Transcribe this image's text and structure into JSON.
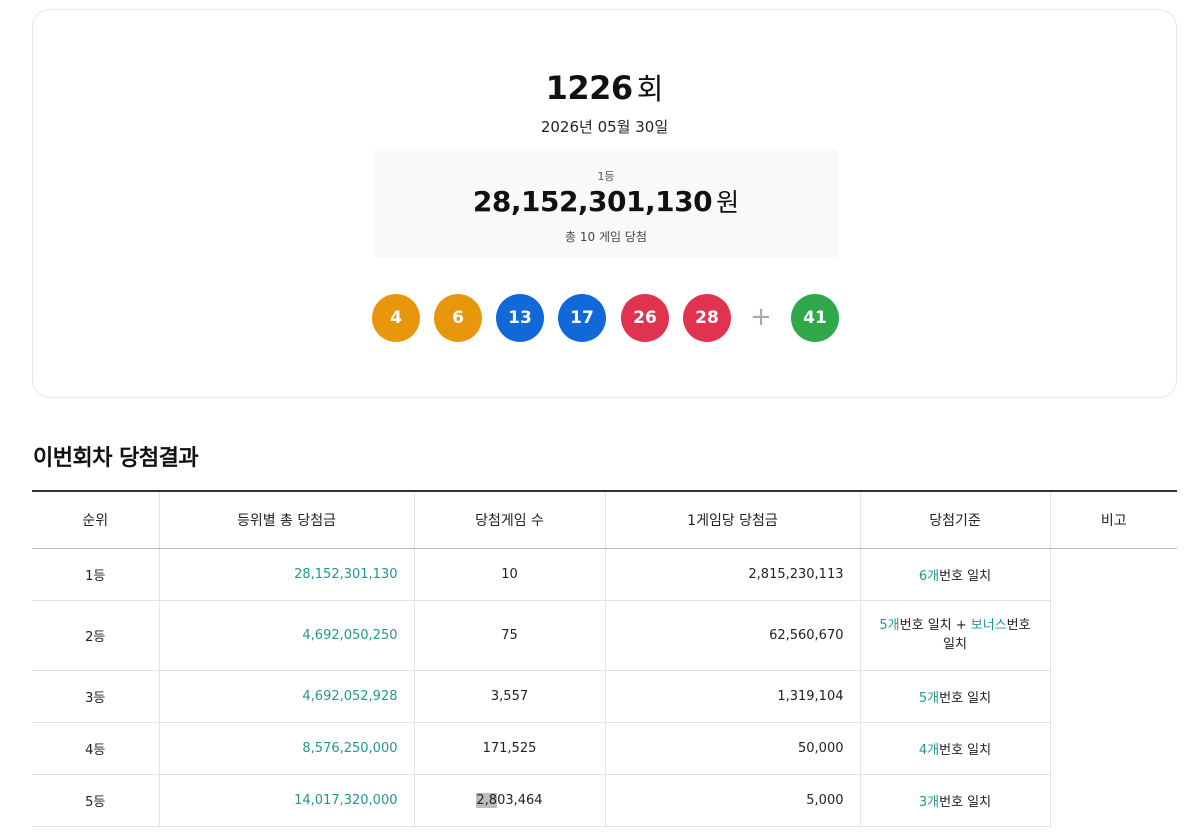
{
  "draw": {
    "number": "1226",
    "unit": "회",
    "date": "2026년 05월 30일"
  },
  "first_prize": {
    "rank": "1등",
    "amount": "28,152,301,130",
    "currency": "원",
    "winners_text": "총 10 게임 당첨"
  },
  "balls": [
    {
      "number": "4",
      "color": "#e8960c"
    },
    {
      "number": "6",
      "color": "#e8960c"
    },
    {
      "number": "13",
      "color": "#1168d8"
    },
    {
      "number": "17",
      "color": "#1168d8"
    },
    {
      "number": "26",
      "color": "#e0334f"
    },
    {
      "number": "28",
      "color": "#e0334f"
    }
  ],
  "plus_sign": "+",
  "bonus_ball": {
    "number": "41",
    "color": "#2fa84a"
  },
  "section_title": "이번회차 당첨결과",
  "table": {
    "headers": [
      "순위",
      "등위별 총 당첨금",
      "당첨게임 수",
      "1게임당 당첨금",
      "당첨기준",
      "비고"
    ],
    "rows": [
      {
        "rank": "1등",
        "total": "28,152,301,130",
        "count": "10",
        "per_game": "2,815,230,113",
        "crit_num": "6개",
        "crit_text": "번호 일치"
      },
      {
        "rank": "2등",
        "total": "4,692,050,250",
        "count": "75",
        "per_game": "62,560,670",
        "crit_num": "5개",
        "crit_text": "번호 일치 + ",
        "crit_bonus": "보너스",
        "crit_tail": "번호 일치"
      },
      {
        "rank": "3등",
        "total": "4,692,052,928",
        "count": "3,557",
        "per_game": "1,319,104",
        "crit_num": "5개",
        "crit_text": "번호 일치"
      },
      {
        "rank": "4등",
        "total": "8,576,250,000",
        "count": "171,525",
        "per_game": "50,000",
        "crit_num": "4개",
        "crit_text": "번호 일치"
      },
      {
        "rank": "5등",
        "total": "14,017,320,000",
        "count_hl": "2,8",
        "count_rest": "03,464",
        "per_game": "5,000",
        "crit_num": "3개",
        "crit_text": "번호 일치"
      }
    ]
  },
  "colors": {
    "accent": "#1f9a8a",
    "ball_yellow": "#e8960c",
    "ball_blue": "#1168d8",
    "ball_red": "#e0334f",
    "ball_green": "#2fa84a"
  }
}
